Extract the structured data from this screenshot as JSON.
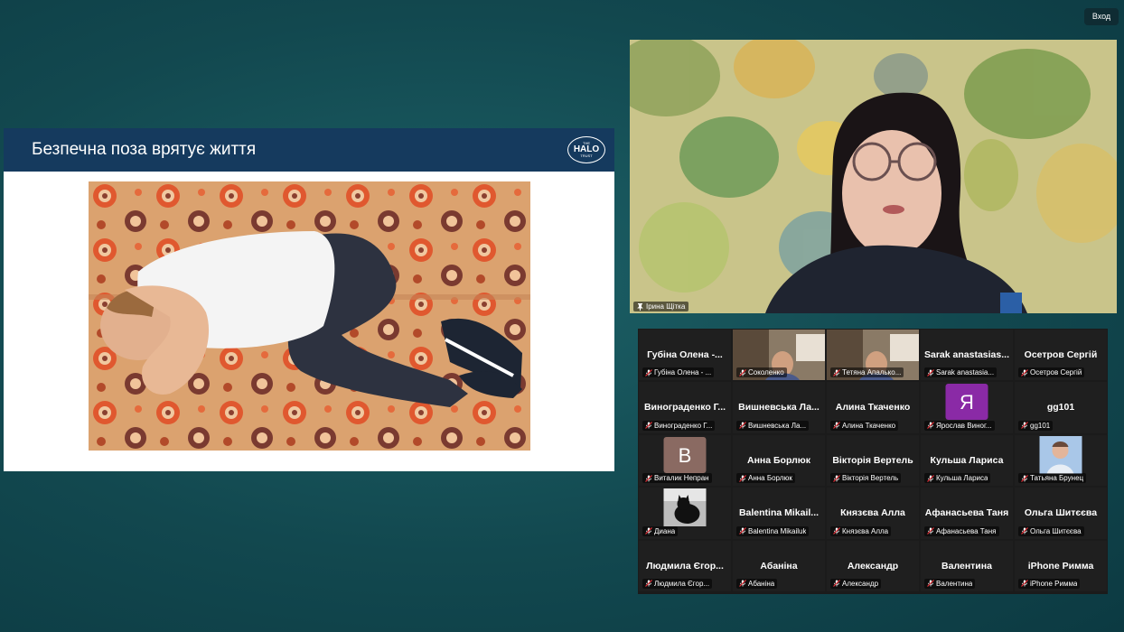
{
  "top_button": {
    "label": "Вход"
  },
  "slide": {
    "title": "Безпечна поза врятує життя",
    "logo": {
      "small_top": "THE",
      "big": "HALO",
      "small_bottom": "TRUST"
    }
  },
  "speaker": {
    "name": "Ірина Щітка",
    "icon": "pin-icon"
  },
  "gallery": {
    "tiles": [
      {
        "big": "Губіна Олена -...",
        "label": "Губіна Олена - ...",
        "kind": "name"
      },
      {
        "big": "",
        "label": "Соколенко",
        "kind": "video"
      },
      {
        "big": "",
        "label": "Тетяна Апалько...",
        "kind": "video"
      },
      {
        "big": "Sarak  anastasias...",
        "label": "Sarak anastasia...",
        "kind": "name"
      },
      {
        "big": "Осетров Сергій",
        "label": "Осетров Сергій",
        "kind": "name"
      },
      {
        "big": "Винограденко  Г...",
        "label": "Винограденко Г...",
        "kind": "name"
      },
      {
        "big": "Вишневська  Ла...",
        "label": "Вишневська Ла...",
        "kind": "name"
      },
      {
        "big": "Алина Ткаченко",
        "label": "Алина Ткаченко",
        "kind": "name"
      },
      {
        "big": "",
        "label": "Ярослав Виног...",
        "kind": "letter",
        "letter": "Я",
        "color": "#8a2aa6"
      },
      {
        "big": "gg101",
        "label": "gg101",
        "kind": "name"
      },
      {
        "big": "",
        "label": "Виталик Непран",
        "kind": "letter",
        "letter": "B",
        "color": "#8a6a62"
      },
      {
        "big": "Анна Борлюк",
        "label": "Анна Борлюк",
        "kind": "name"
      },
      {
        "big": "Вікторія Вертель",
        "label": "Вікторія Вертель",
        "kind": "name"
      },
      {
        "big": "Кульша Лариса",
        "label": "Кульша Лариса",
        "kind": "name"
      },
      {
        "big": "",
        "label": "Татьяна Брунец",
        "kind": "photo"
      },
      {
        "big": "",
        "label": "Диана",
        "kind": "cat"
      },
      {
        "big": "Balentina  Mikail...",
        "label": "Balentina Mikailuk",
        "kind": "name"
      },
      {
        "big": "Князєва Алла",
        "label": "Князєва Алла",
        "kind": "name"
      },
      {
        "big": "Афанасьева Таня",
        "label": "Афанасьева Таня",
        "kind": "name"
      },
      {
        "big": "Ольга Шитєєва",
        "label": "Ольга Шитєєва",
        "kind": "name"
      },
      {
        "big": "Людмила Єгор...",
        "label": "Людмила Єгор...",
        "kind": "name"
      },
      {
        "big": "Абаніна",
        "label": "Абаніна",
        "kind": "name"
      },
      {
        "big": "Александр",
        "label": "Александр",
        "kind": "name"
      },
      {
        "big": "Валентина",
        "label": "Валентина",
        "kind": "name"
      },
      {
        "big": "iPhone Римма",
        "label": "iPhone Римма",
        "kind": "name"
      }
    ],
    "mute_icon": "muted-mic-icon"
  }
}
